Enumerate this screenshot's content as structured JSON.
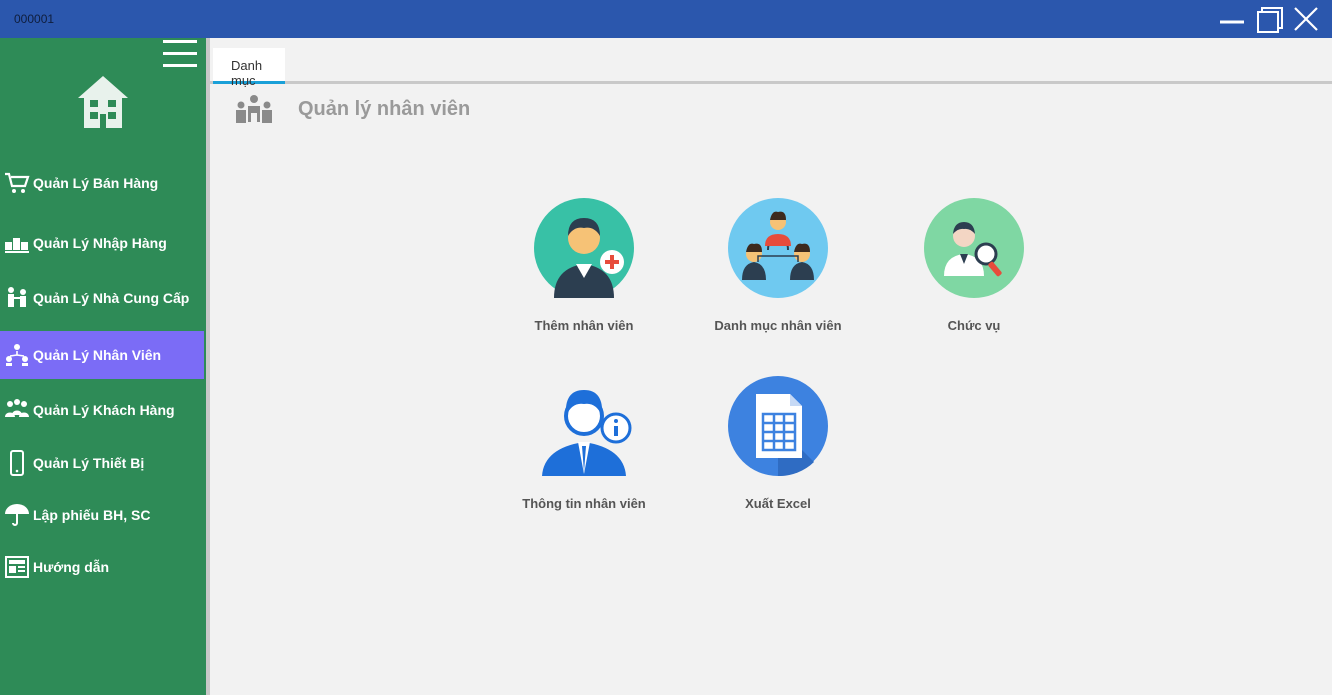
{
  "window": {
    "title": "000001"
  },
  "sidebar": {
    "items": [
      {
        "label": "Quản Lý Bán Hàng",
        "icon": "cart-icon"
      },
      {
        "label": "Quản Lý Nhập Hàng",
        "icon": "import-goods-icon"
      },
      {
        "label": "Quản Lý Nhà Cung Cấp",
        "icon": "supplier-icon"
      },
      {
        "label": "Quản Lý Nhân Viên",
        "icon": "employee-network-icon",
        "active": true
      },
      {
        "label": "Quản Lý Khách Hàng",
        "icon": "customers-icon"
      },
      {
        "label": "Quản Lý Thiết Bị",
        "icon": "phone-device-icon"
      },
      {
        "label": "Lập phiếu BH, SC",
        "icon": "umbrella-icon"
      },
      {
        "label": "Hướng dẫn",
        "icon": "newspaper-icon"
      }
    ]
  },
  "tabs": [
    {
      "label": "Danh mục"
    }
  ],
  "main": {
    "heading": "Quản lý nhân viên",
    "tiles": [
      {
        "label": "Thêm nhân viên",
        "icon": "add-employee-icon"
      },
      {
        "label": "Danh mục nhân viên",
        "icon": "employee-list-icon"
      },
      {
        "label": "Chức vụ",
        "icon": "position-search-icon"
      },
      {
        "label": "Thông tin  nhân viên",
        "icon": "employee-info-icon"
      },
      {
        "label": "Xuất Excel",
        "icon": "excel-sheet-icon"
      }
    ]
  },
  "colors": {
    "titlebar": "#2b57ad",
    "sidebar": "#2e8b57",
    "active_item": "#7b6cf6",
    "content_bg": "#f2f2f2",
    "tab_accent": "#1aa0d8"
  }
}
